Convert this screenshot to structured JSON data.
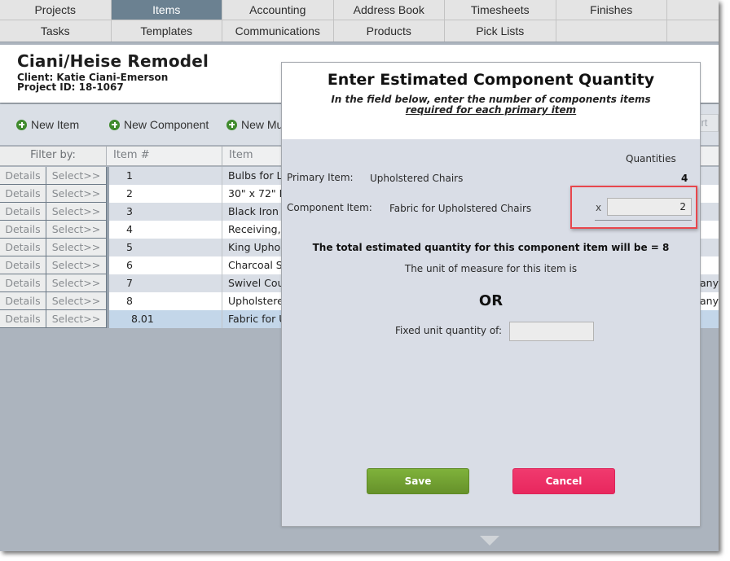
{
  "nav": {
    "row1": [
      "Projects",
      "Items",
      "Accounting",
      "Address Book",
      "Timesheets",
      "Finishes"
    ],
    "row2": [
      "Tasks",
      "Templates",
      "Communications",
      "Products",
      "Pick Lists"
    ],
    "active": "Items"
  },
  "project": {
    "title": "Ciani/Heise Remodel",
    "client": "Client: Katie Ciani-Emerson",
    "project_id": "Project ID: 18-1067"
  },
  "toolbar": {
    "new_item": "New Item",
    "new_component": "New Component",
    "new_multi": "New Mul",
    "right_partial": "port"
  },
  "table": {
    "headers": {
      "filter": "Filter by:",
      "item_num": "Item #",
      "item_name": "Item Name"
    },
    "details_label": "Details",
    "select_label": "Select>>",
    "rows": [
      {
        "num": "1",
        "name": "Bulbs for L",
        "right": ""
      },
      {
        "num": "2",
        "name": "30\" x 72\" F",
        "right": ""
      },
      {
        "num": "3",
        "name": "Black Iron",
        "right": ""
      },
      {
        "num": "4",
        "name": "Receiving,",
        "right": ""
      },
      {
        "num": "5",
        "name": "King Uphol",
        "right": ""
      },
      {
        "num": "6",
        "name": "Charcoal S",
        "right": ""
      },
      {
        "num": "7",
        "name": "Swivel Cou",
        "right": "pany"
      },
      {
        "num": "8",
        "name": "Upholstere",
        "right": "pany"
      },
      {
        "num": "8.01",
        "name": "Fabric for U",
        "right": ""
      }
    ]
  },
  "modal": {
    "title": "Enter Estimated Component Quantity",
    "instruction_line1": "In the field below, enter the number of components items",
    "instruction_line2": "required for each primary item",
    "quantities_header": "Quantities",
    "primary_label": "Primary Item:",
    "primary_value": "Upholstered Chairs",
    "primary_qty": "4",
    "component_label": "Component Item:",
    "component_value": "Fabric for Upholstered Chairs",
    "multiplier_sign": "x",
    "component_qty": "2",
    "total_line": "The total estimated quantity for this component item will be = 8",
    "uom_line": "The unit of measure for this item is",
    "or_text": "OR",
    "fixed_label": "Fixed unit quantity of:",
    "fixed_value": "",
    "save_label": "Save",
    "cancel_label": "Cancel"
  },
  "colors": {
    "active_tab": "#6b8191",
    "save": "#72a332",
    "cancel": "#ec2f65",
    "highlight": "#e8474d",
    "selected_row": "#c3d6e9"
  }
}
